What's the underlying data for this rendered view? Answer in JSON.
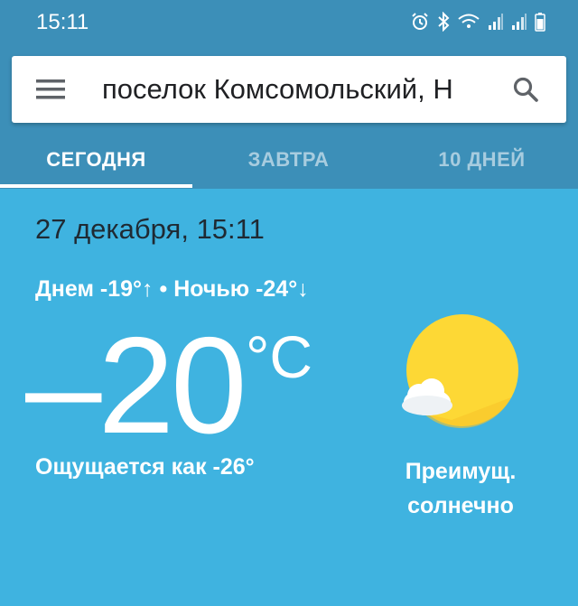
{
  "status_bar": {
    "time": "15:11",
    "icons": [
      "alarm-icon",
      "bluetooth-icon",
      "wifi-icon",
      "signal-icon",
      "signal-icon",
      "battery-icon"
    ]
  },
  "search": {
    "value": "поселок Комсомольский, Н"
  },
  "tabs": [
    {
      "label": "СЕГОДНЯ",
      "active": true
    },
    {
      "label": "ЗАВТРА",
      "active": false
    },
    {
      "label": "10 ДНЕЙ",
      "active": false
    }
  ],
  "weather": {
    "date": "27 декабря, 15:11",
    "day_night": "Днем -19°↑ • Ночью -24°↓",
    "temperature": "–20",
    "unit": "°C",
    "feels_like": "Ощущается как -26°",
    "condition_line1": "Преимущ.",
    "condition_line2": "солнечно",
    "icon": "partly-sunny-icon"
  },
  "colors": {
    "header": "#3c8fb8",
    "background": "#3fb3e0",
    "sun": "#fdd835"
  }
}
